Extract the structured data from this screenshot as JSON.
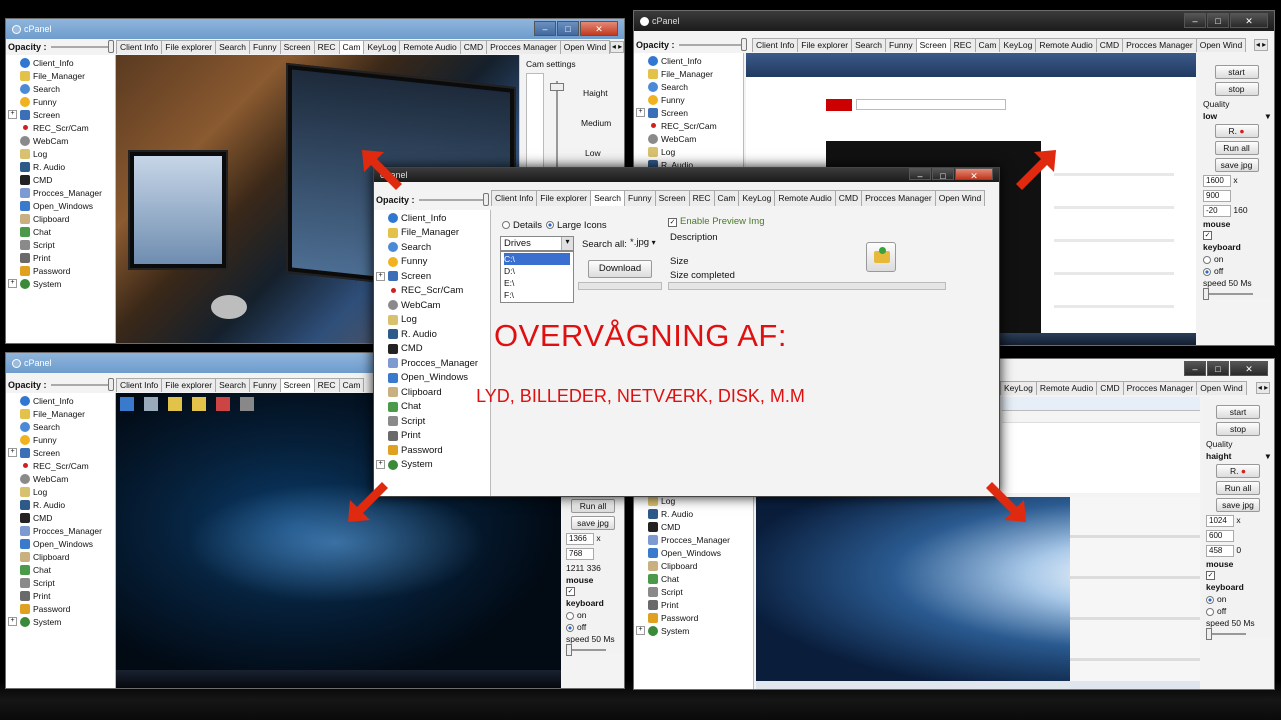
{
  "app_title": "cPanel",
  "opacity_label": "Opacity :",
  "tabs": [
    "Client Info",
    "File explorer",
    "Search",
    "Funny",
    "Screen",
    "REC",
    "Cam",
    "KeyLog",
    "Remote Audio",
    "CMD",
    "Procces Manager",
    "Open Wind"
  ],
  "tab_scroll": "◂ ▸",
  "tree": [
    {
      "label": "Client_Info",
      "icon": "info-icon",
      "color": "#2f77d0"
    },
    {
      "label": "File_Manager",
      "icon": "folder-icon",
      "color": "#e3c24a"
    },
    {
      "label": "Search",
      "icon": "search-icon",
      "color": "#4a8ad6"
    },
    {
      "label": "Funny",
      "icon": "smiley-icon",
      "color": "#f0b31f"
    },
    {
      "label": "Screen",
      "icon": "monitor-icon",
      "color": "#3b6fb8"
    },
    {
      "label": "REC_Scr/Cam",
      "icon": "record-icon",
      "color": "#d02020"
    },
    {
      "label": "WebCam",
      "icon": "webcam-icon",
      "color": "#8a8a8a"
    },
    {
      "label": "Log",
      "icon": "log-icon",
      "color": "#d8c270"
    },
    {
      "label": "R. Audio",
      "icon": "speaker-icon",
      "color": "#2e5a8a"
    },
    {
      "label": "CMD",
      "icon": "terminal-icon",
      "color": "#222222"
    },
    {
      "label": "Procces_Manager",
      "icon": "process-icon",
      "color": "#7d9bd0"
    },
    {
      "label": "Open_Windows",
      "icon": "windows-icon",
      "color": "#3a7acc"
    },
    {
      "label": "Clipboard",
      "icon": "clipboard-icon",
      "color": "#c8b080"
    },
    {
      "label": "Chat",
      "icon": "chat-icon",
      "color": "#4a9a4a"
    },
    {
      "label": "Script",
      "icon": "script-icon",
      "color": "#8a8a8a"
    },
    {
      "label": "Print",
      "icon": "printer-icon",
      "color": "#6a6a6a"
    },
    {
      "label": "Password",
      "icon": "lock-icon",
      "color": "#e0a020"
    },
    {
      "label": "System",
      "icon": "system-icon",
      "color": "#3a8a3a"
    }
  ],
  "cam": {
    "settings_title": "Cam settings",
    "height_label": "Haight",
    "medium_label": "Medium",
    "low_label": "Low"
  },
  "screen_tr": {
    "start": "start",
    "stop": "stop",
    "quality_label": "Quality",
    "quality_value": "low",
    "rec_label": "R.",
    "run_all": "Run all",
    "save_jpg": "save jpg",
    "w": "1600",
    "x": "x",
    "h": "900",
    "ox": "-20",
    "oy": "160",
    "mouse": "mouse",
    "keyboard": "keyboard",
    "on": "on",
    "off": "off",
    "speed": "speed 50 Ms"
  },
  "screen_br": {
    "start": "start",
    "stop": "stop",
    "quality_label": "Quality",
    "quality_value": "haight",
    "rec_label": "R.",
    "run_all": "Run all",
    "save_jpg": "save jpg",
    "w": "1024",
    "x": "x",
    "h": "600",
    "ox": "458",
    "oy": "0",
    "mouse": "mouse",
    "keyboard": "keyboard",
    "on": "on",
    "off": "off",
    "speed": "speed 50 Ms"
  },
  "screen_bl": {
    "run_all": "Run all",
    "save_jpg": "save jpg",
    "w": "1366",
    "x": "x",
    "h": "768",
    "ox": "1211",
    "oy": "336",
    "mouse": "mouse",
    "keyboard": "keyboard",
    "on": "on",
    "off": "off",
    "speed": "speed 50 Ms"
  },
  "search": {
    "details": "Details",
    "large_icons": "Large Icons",
    "drives_value": "Drives",
    "search_all_label": "Search all:",
    "ext_value": "*.jpg",
    "drive_options": [
      "C:\\",
      "D:\\",
      "E:\\",
      "F:\\"
    ],
    "download": "Download",
    "enable_preview": "Enable Preview Img",
    "description": "Description",
    "size": "Size",
    "size_completed": "Size completed"
  },
  "headline": "OVERVÅGNING AF:",
  "subline": "LYD, BILLEDER, NETVÆRK, DISK, M.M",
  "colors": {
    "accent_red": "#e01010",
    "arrow_red": "#e02a10"
  }
}
